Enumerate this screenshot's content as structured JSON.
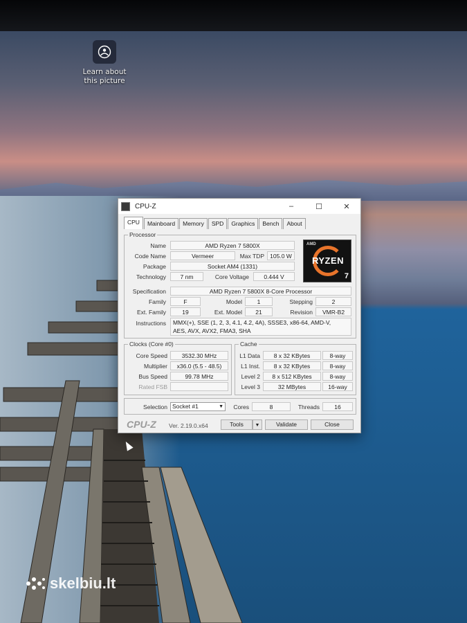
{
  "desktop": {
    "learn_about_line1": "Learn about",
    "learn_about_line2": "this picture",
    "watermark": "skelbiu.lt"
  },
  "window": {
    "title": "CPU-Z",
    "tabs": [
      "CPU",
      "Mainboard",
      "Memory",
      "SPD",
      "Graphics",
      "Bench",
      "About"
    ],
    "active_tab": "CPU"
  },
  "processor": {
    "legend": "Processor",
    "name_label": "Name",
    "name": "AMD Ryzen 7 5800X",
    "code_name_label": "Code Name",
    "code_name": "Vermeer",
    "max_tdp_label": "Max TDP",
    "max_tdp": "105.0 W",
    "package_label": "Package",
    "package": "Socket AM4 (1331)",
    "technology_label": "Technology",
    "technology": "7 nm",
    "core_voltage_label": "Core Voltage",
    "core_voltage": "0.444 V",
    "specification_label": "Specification",
    "specification": "AMD Ryzen 7 5800X 8-Core Processor",
    "family_label": "Family",
    "family": "F",
    "model_label": "Model",
    "model": "1",
    "stepping_label": "Stepping",
    "stepping": "2",
    "ext_family_label": "Ext. Family",
    "ext_family": "19",
    "ext_model_label": "Ext. Model",
    "ext_model": "21",
    "revision_label": "Revision",
    "revision": "VMR-B2",
    "instructions_label": "Instructions",
    "instructions_line1": "MMX(+), SSE (1, 2, 3, 4.1, 4.2, 4A), SSSE3, x86-64, AMD-V,",
    "instructions_line2": "AES, AVX, AVX2, FMA3, SHA",
    "logo_brand": "AMD",
    "logo_text": "RYZEN",
    "logo_tier": "7"
  },
  "clocks": {
    "legend": "Clocks (Core #0)",
    "core_speed_label": "Core Speed",
    "core_speed": "3532.30 MHz",
    "multiplier_label": "Multiplier",
    "multiplier": "x36.0 (5.5 - 48.5)",
    "bus_speed_label": "Bus Speed",
    "bus_speed": "99.78 MHz",
    "rated_fsb_label": "Rated FSB",
    "rated_fsb": ""
  },
  "cache": {
    "legend": "Cache",
    "rows": [
      {
        "label": "L1 Data",
        "size": "8 x 32 KBytes",
        "assoc": "8-way"
      },
      {
        "label": "L1 Inst.",
        "size": "8 x 32 KBytes",
        "assoc": "8-way"
      },
      {
        "label": "Level 2",
        "size": "8 x 512 KBytes",
        "assoc": "8-way"
      },
      {
        "label": "Level 3",
        "size": "32 MBytes",
        "assoc": "16-way"
      }
    ]
  },
  "selection": {
    "label": "Selection",
    "value": "Socket #1",
    "cores_label": "Cores",
    "cores": "8",
    "threads_label": "Threads",
    "threads": "16"
  },
  "footer": {
    "brand": "CPU-Z",
    "version": "Ver. 2.19.0.x64",
    "tools_label": "Tools",
    "validate_label": "Validate",
    "close_label": "Close"
  }
}
